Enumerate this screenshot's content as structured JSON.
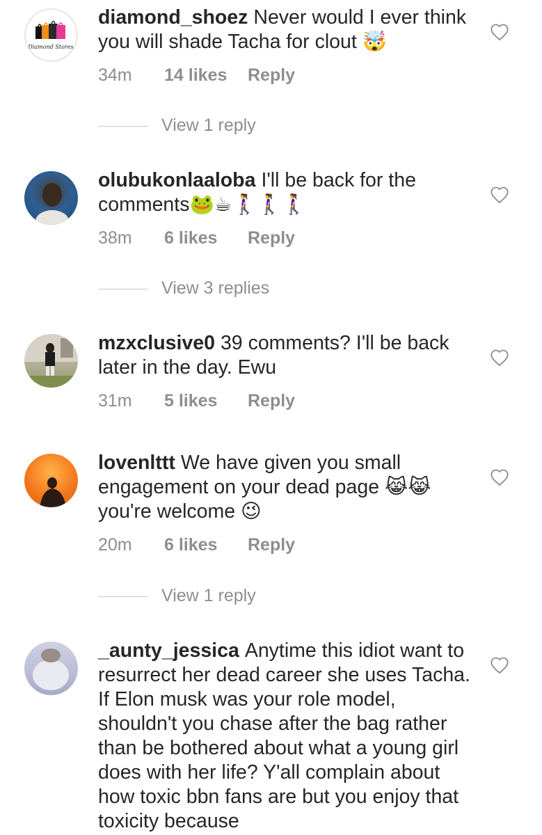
{
  "comments": [
    {
      "username": "diamond_shoez",
      "text": "Never would I ever think you will shade Tacha for clout 🤯",
      "time": "34m",
      "likes": "14 likes",
      "reply": "Reply",
      "avatar_caption": "Diamond Stores",
      "view_replies": "View 1 reply"
    },
    {
      "username": "olubukonlaaloba",
      "text": "I'll be back for the comments🐸☕🚶‍♀️🚶‍♀️🚶‍♀️",
      "time": "38m",
      "likes": "6 likes",
      "reply": "Reply",
      "view_replies": "View 3 replies"
    },
    {
      "username": "mzxclusive0",
      "text": "39 comments? I'll be back later in the day. Ewu",
      "time": "31m",
      "likes": "5 likes",
      "reply": "Reply"
    },
    {
      "username": "lovenlttt",
      "text": "We have given you small engagement on your dead page 😹😹 you're welcome 😉",
      "time": "20m",
      "likes": "6 likes",
      "reply": "Reply",
      "view_replies": "View 1 reply"
    },
    {
      "username": "_aunty_jessica",
      "text": "Anytime this idiot want to resurrect her dead career she uses Tacha. If Elon musk was your role model, shouldn't you chase after the bag rather than be bothered about what a young girl does with her life? Y'all complain about how toxic bbn fans are but you enjoy that toxicity because"
    }
  ],
  "icons": {
    "like": "heart-outline-icon"
  },
  "colors": {
    "text": "#262626",
    "secondary": "#8e8e8e",
    "divider": "#c7c7c7"
  }
}
